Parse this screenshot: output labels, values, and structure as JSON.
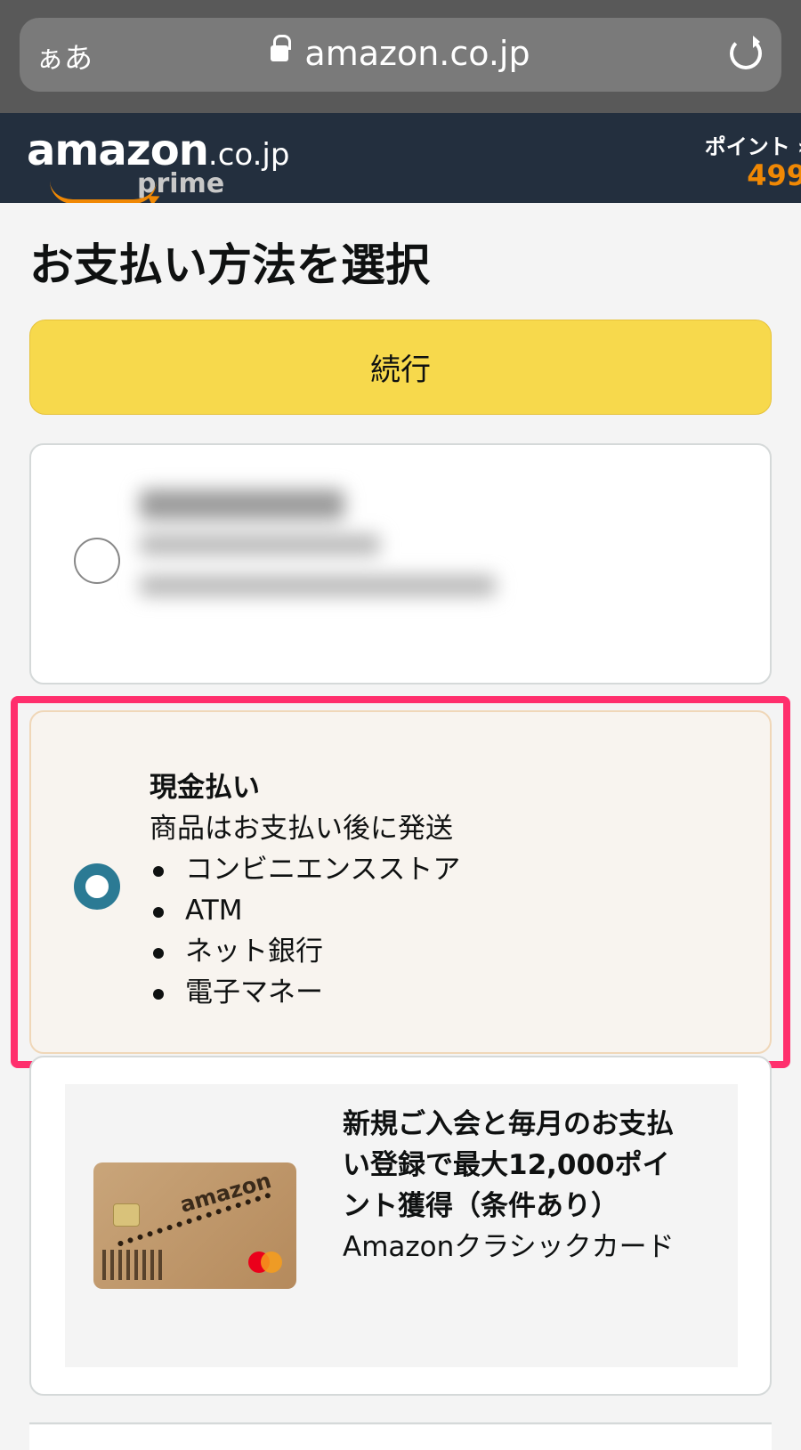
{
  "browser": {
    "text_size_label": "ぁあ",
    "url": "amazon.co.jp"
  },
  "header": {
    "logo_text": "amazon",
    "logo_tld": ".co.jp",
    "logo_sub": "prime",
    "points_label": "ポイント ›",
    "points_value": "499"
  },
  "main": {
    "title": "お支払い方法を選択",
    "continue_label": "続行"
  },
  "payment_options": {
    "cash": {
      "title": "現金払い",
      "subtitle": "商品はお支払い後に発送",
      "methods": [
        "コンビニエンスストア",
        "ATM",
        "ネット銀行",
        "電子マネー"
      ],
      "selected": true
    },
    "promo": {
      "headline": "新規ご入会と毎月のお支払い登録で最大12,000ポイント獲得（条件あり）",
      "product_name": "Amazonクラシックカード",
      "card_logo": "amazon"
    }
  },
  "colors": {
    "accent_button": "#f7d94c",
    "header_bg": "#232f3e",
    "points": "#f08804",
    "radio_selected": "#2b7a94",
    "highlight": "#ff2f6d"
  }
}
